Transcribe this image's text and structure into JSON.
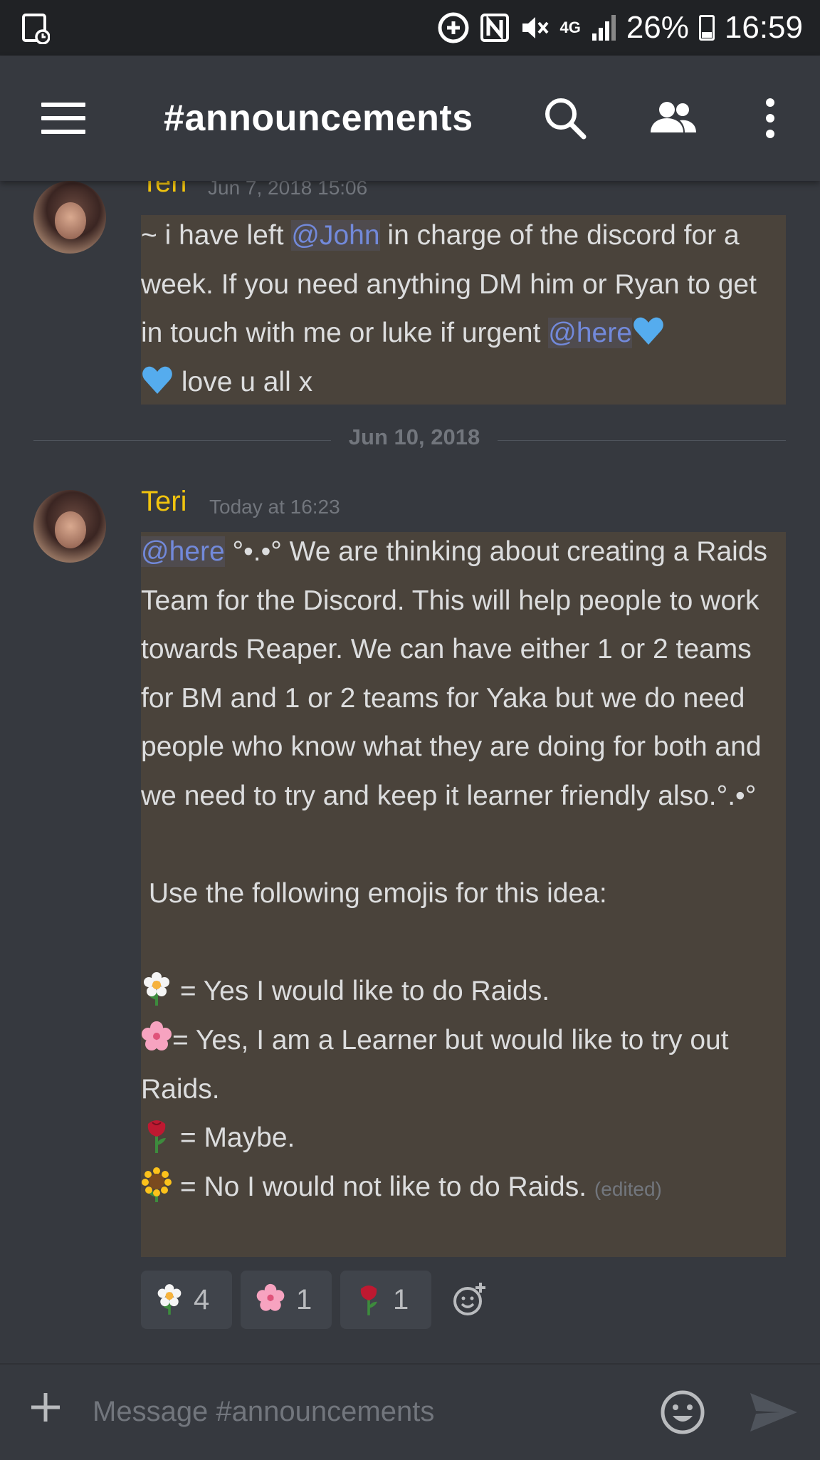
{
  "status_bar": {
    "battery": "26%",
    "time": "16:59",
    "network": "4G"
  },
  "header": {
    "channel_title": "#announcements",
    "icons": [
      "menu-icon",
      "search-icon",
      "members-icon",
      "more-icon"
    ]
  },
  "messages": [
    {
      "author": "Teri",
      "timestamp": "Jun 7, 2018 15:06",
      "prefix": "~ i have left ",
      "mention1": "@John",
      "text_mid": " in charge of the discord for a week. If you need anything DM him or Ryan to get in touch with me or luke if urgent ",
      "mention2": "@here",
      "text_end": " love u all x"
    },
    {
      "author": "Teri",
      "timestamp": "Today at 16:23",
      "mention": "@here",
      "para1": " °•.•° We are thinking about creating a Raids Team for the Discord. This will help people to work towards Reaper. We can have either 1 or 2 teams for BM and 1 or 2 teams for Yaka but we do need people who know what they are doing for both and we need to try and keep it learner friendly also.°.•°",
      "para2": " Use the following emojis for this idea:",
      "opt1": " = Yes I would like to do Raids.",
      "opt2": "= Yes, I am a Learner but would like to try out Raids.",
      "opt3": " = Maybe.",
      "opt4": " = No I would not like to do Raids.",
      "edited": "(edited)"
    }
  ],
  "date_divider": "Jun 10, 2018",
  "reactions": [
    {
      "emoji": "white-flower",
      "count": "4"
    },
    {
      "emoji": "cherry-blossom",
      "count": "1"
    },
    {
      "emoji": "rose",
      "count": "1"
    }
  ],
  "composer": {
    "placeholder": "Message #announcements"
  },
  "colors": {
    "background": "#36393f",
    "username": "#f1c40f",
    "mention": "#7289da",
    "highlight": "#4a433b",
    "muted": "#72767d"
  }
}
